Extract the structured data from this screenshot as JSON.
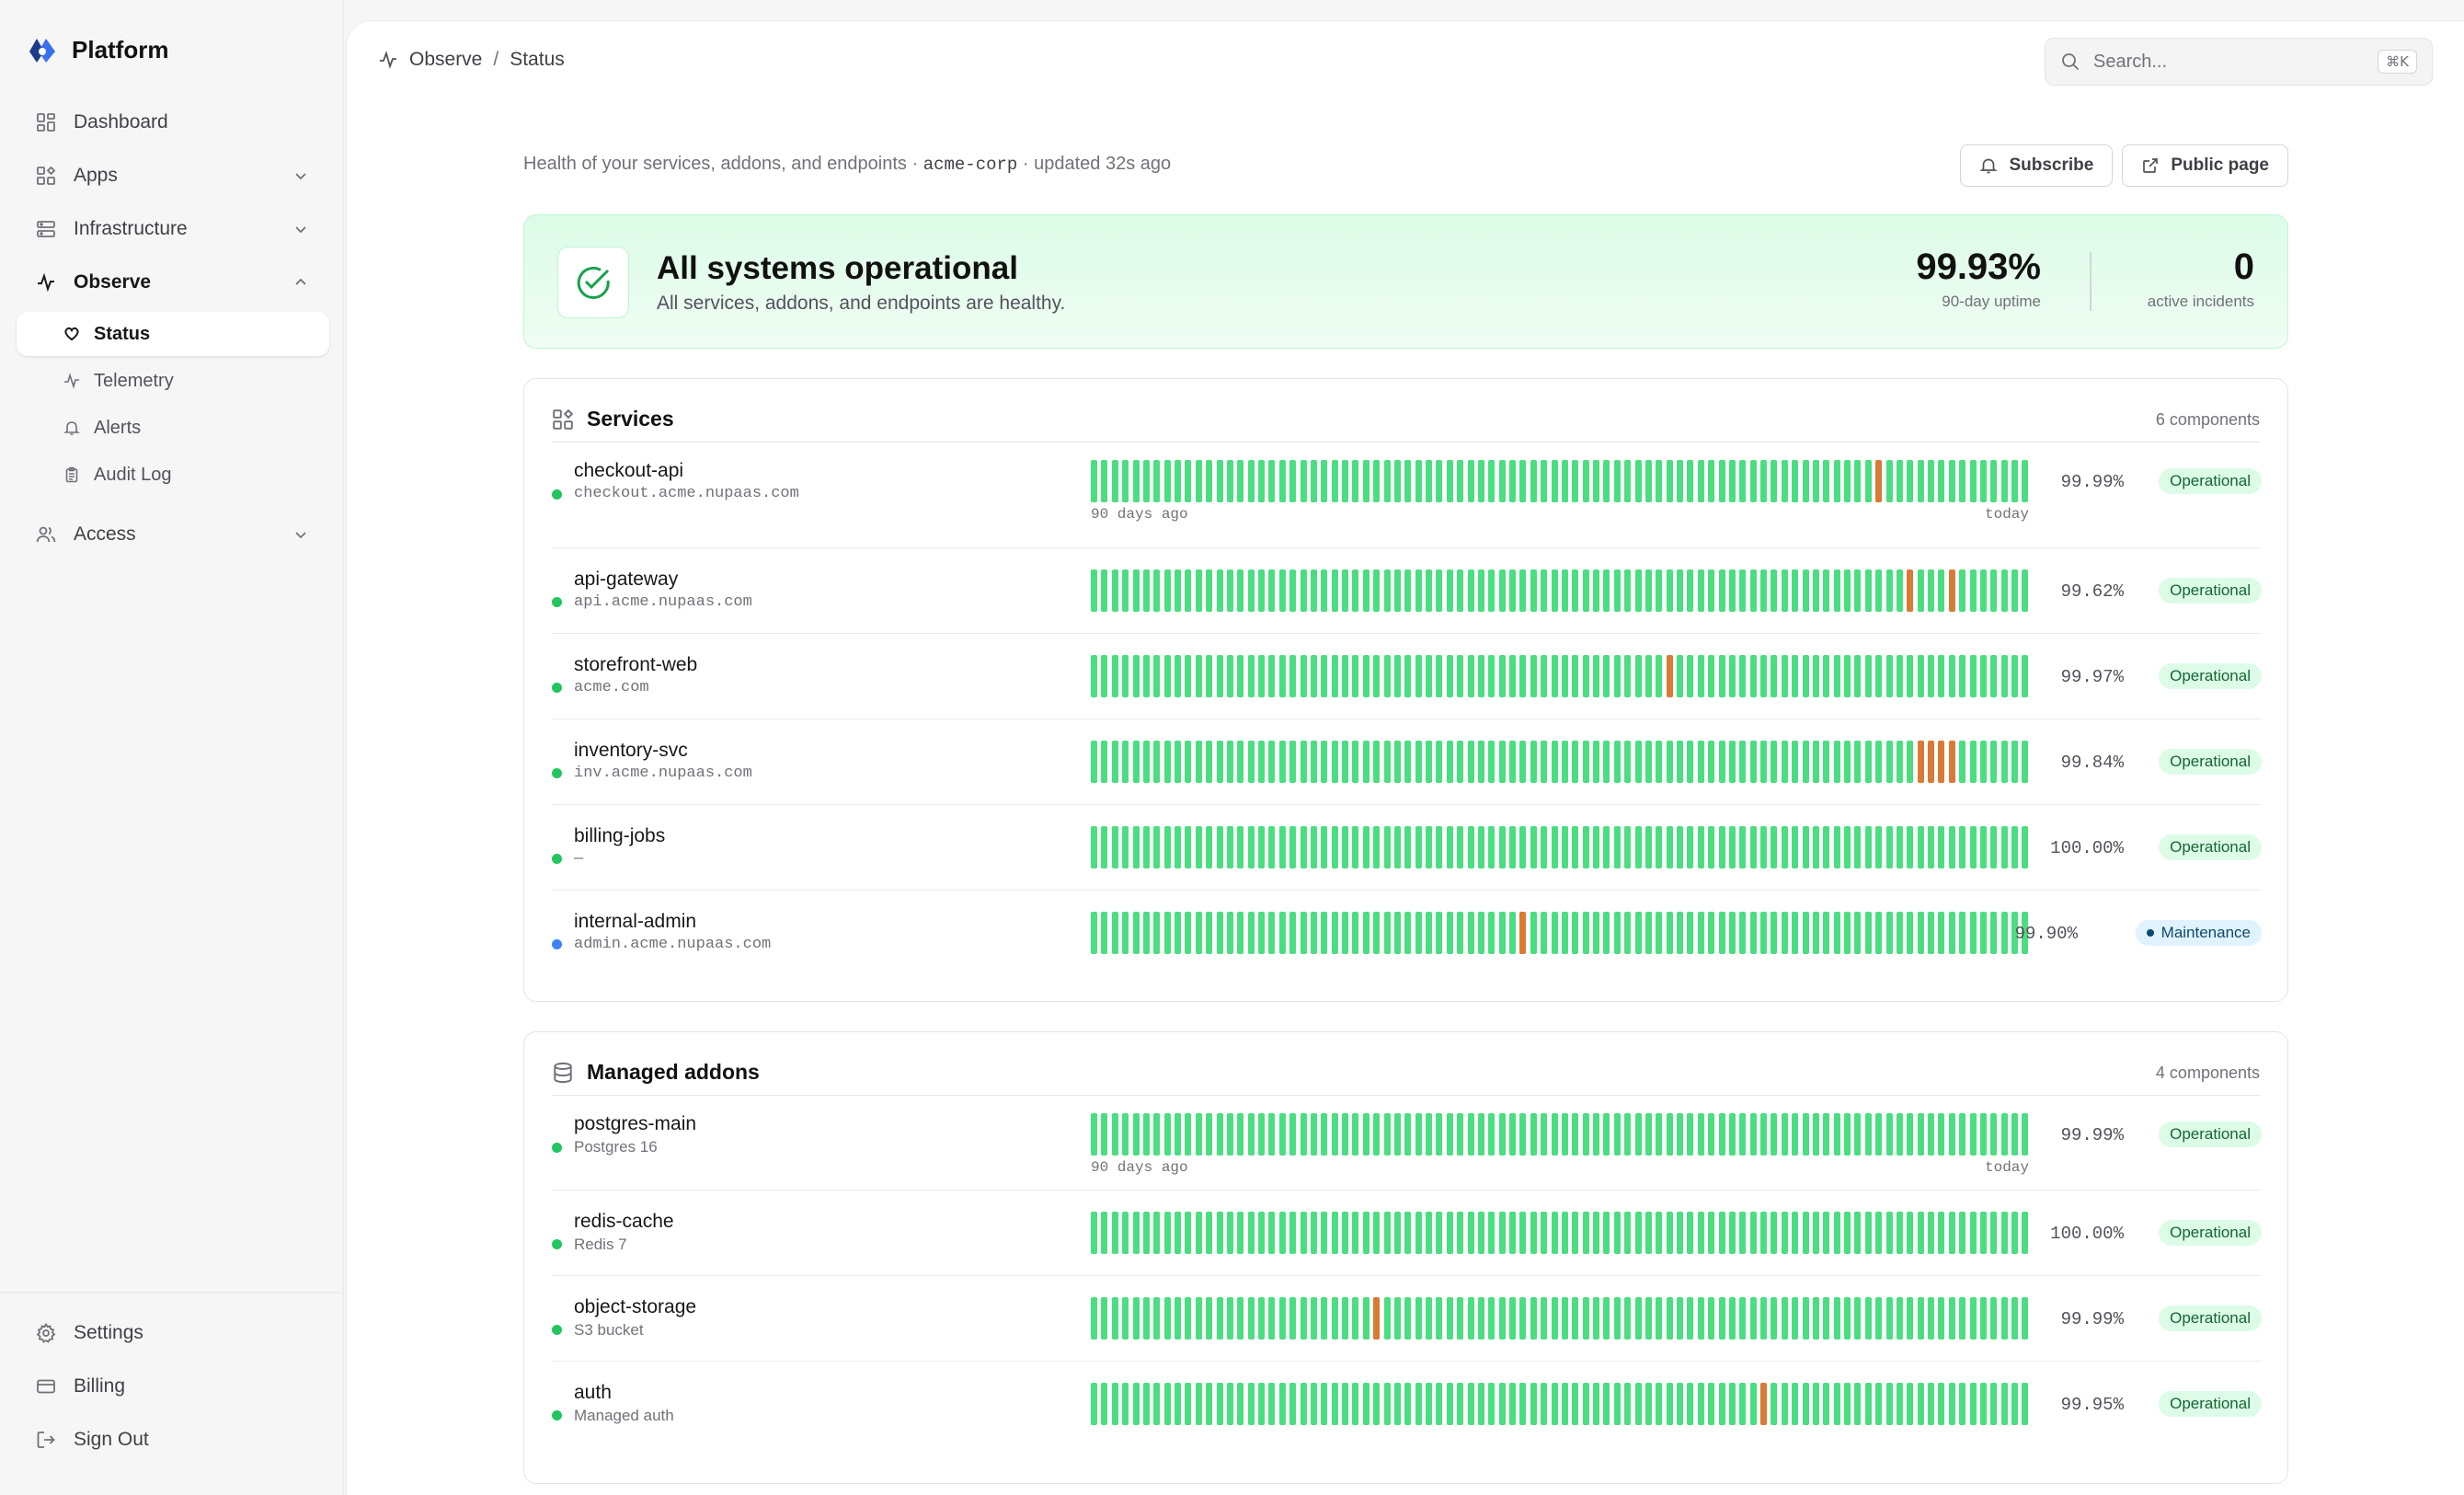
{
  "app": {
    "name": "Platform"
  },
  "sidebar": {
    "items": [
      {
        "label": "Dashboard"
      },
      {
        "label": "Apps"
      },
      {
        "label": "Infrastructure"
      },
      {
        "label": "Observe"
      },
      {
        "label": "Access"
      }
    ],
    "observe_children": [
      {
        "label": "Status"
      },
      {
        "label": "Telemetry"
      },
      {
        "label": "Alerts"
      },
      {
        "label": "Audit Log"
      }
    ],
    "bottom": [
      {
        "label": "Settings"
      },
      {
        "label": "Billing"
      },
      {
        "label": "Sign Out"
      }
    ]
  },
  "breadcrumb": {
    "parent": "Observe",
    "separator": "/",
    "current": "Status"
  },
  "search": {
    "placeholder": "Search...",
    "shortcut": "⌘K"
  },
  "header": {
    "subtitle_prefix": "Health of your services, addons, and endpoints · ",
    "org": "acme-corp",
    "subtitle_suffix": " · updated 32s ago",
    "subscribe_label": "Subscribe",
    "public_page_label": "Public page"
  },
  "summary": {
    "title": "All systems operational",
    "description": "All services, addons, and endpoints are healthy.",
    "uptime_value": "99.93%",
    "uptime_label": "90-day uptime",
    "incidents_value": "0",
    "incidents_label": "active incidents"
  },
  "axis": {
    "start": "90 days ago",
    "end": "today"
  },
  "colors": {
    "operational": "#4ade80",
    "degraded": "#d97a35",
    "maintenance": "#3b82f6"
  },
  "sections": [
    {
      "title": "Services",
      "count": "6 components",
      "components": [
        {
          "name": "checkout-api",
          "sub": "checkout.acme.nupaas.com",
          "uptime": "99.99%",
          "status": "Operational",
          "degraded_days": [
            75
          ]
        },
        {
          "name": "api-gateway",
          "sub": "api.acme.nupaas.com",
          "uptime": "99.62%",
          "status": "Operational",
          "degraded_days": [
            78,
            82
          ]
        },
        {
          "name": "storefront-web",
          "sub": "acme.com",
          "uptime": "99.97%",
          "status": "Operational",
          "degraded_days": [
            55
          ]
        },
        {
          "name": "inventory-svc",
          "sub": "inv.acme.nupaas.com",
          "uptime": "99.84%",
          "status": "Operational",
          "degraded_days": [
            79,
            80,
            81,
            82
          ]
        },
        {
          "name": "billing-jobs",
          "sub": "—",
          "uptime": "100.00%",
          "status": "Operational",
          "degraded_days": []
        },
        {
          "name": "internal-admin",
          "sub": "admin.acme.nupaas.com",
          "uptime": "99.90%",
          "status": "Maintenance",
          "degraded_days": [
            41
          ]
        }
      ]
    },
    {
      "title": "Managed addons",
      "count": "4 components",
      "components": [
        {
          "name": "postgres-main",
          "sub": "Postgres 16",
          "uptime": "99.99%",
          "status": "Operational",
          "degraded_days": []
        },
        {
          "name": "redis-cache",
          "sub": "Redis 7",
          "uptime": "100.00%",
          "status": "Operational",
          "degraded_days": []
        },
        {
          "name": "object-storage",
          "sub": "S3 bucket",
          "uptime": "99.99%",
          "status": "Operational",
          "degraded_days": [
            27
          ]
        },
        {
          "name": "auth",
          "sub": "Managed auth",
          "uptime": "99.95%",
          "status": "Operational",
          "degraded_days": [
            64
          ]
        }
      ]
    }
  ]
}
